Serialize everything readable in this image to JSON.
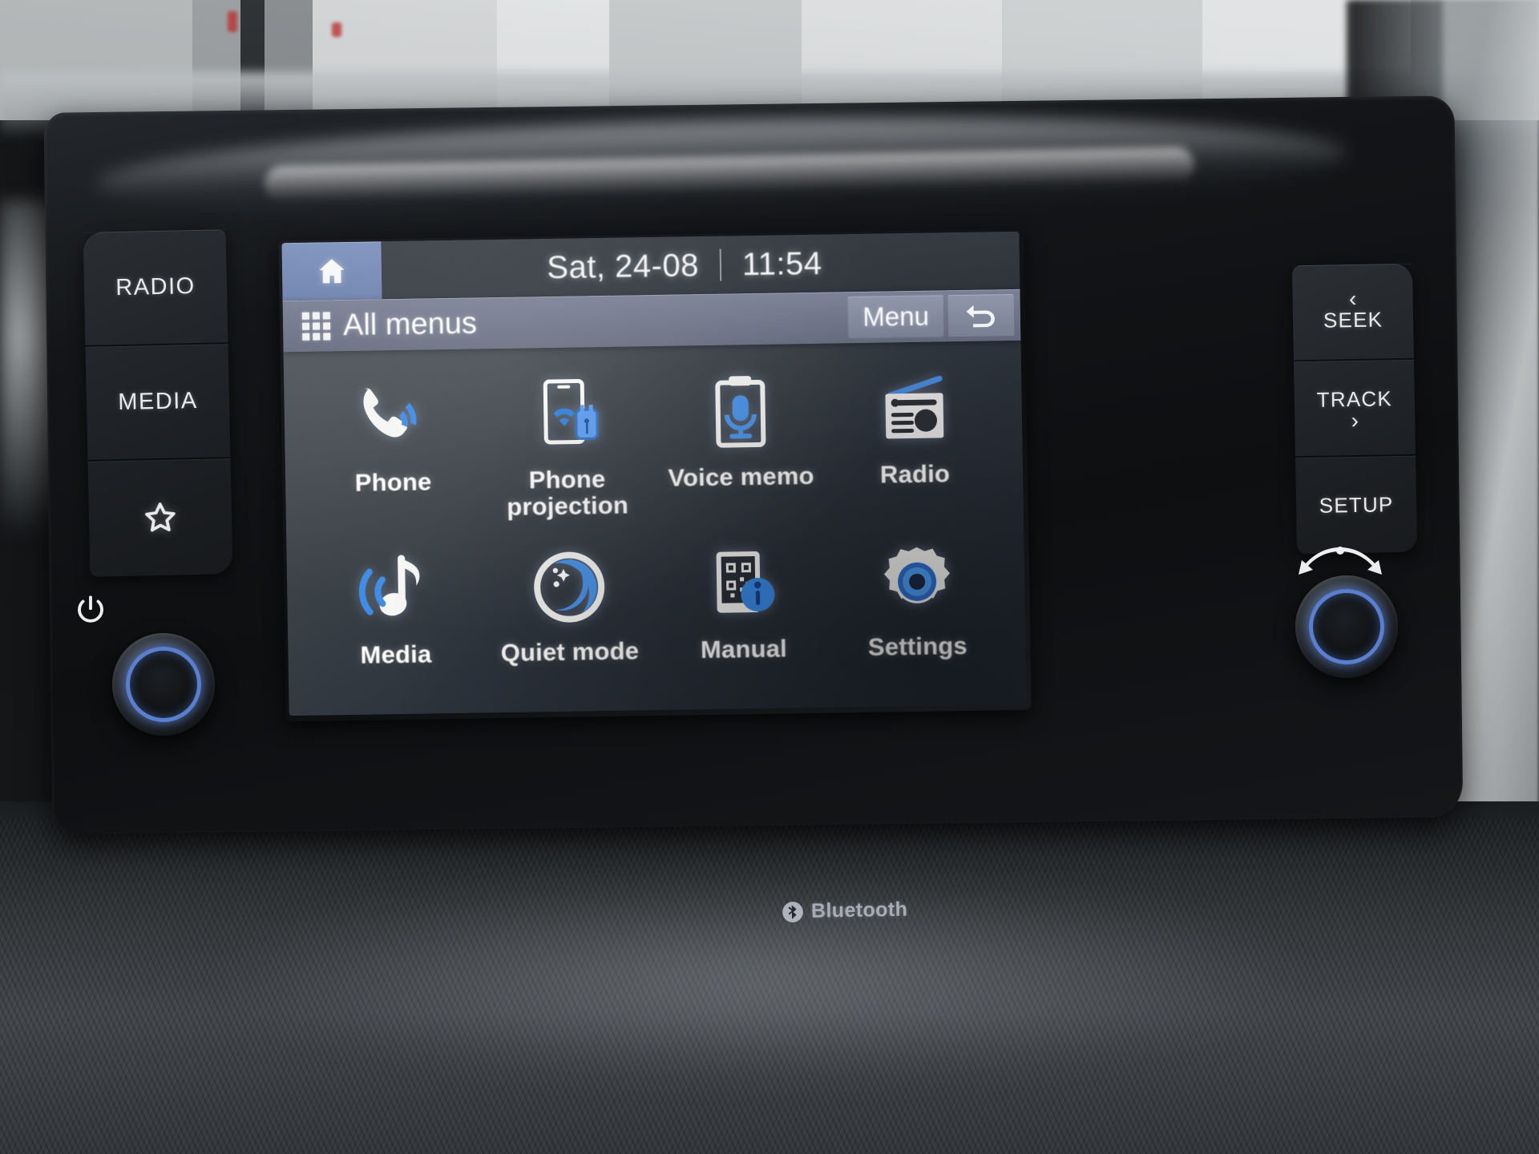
{
  "device": {
    "name": "Car infotainment head unit",
    "brand_badge": "Bluetooth"
  },
  "screen": {
    "status_bar": {
      "home_icon": "home-icon",
      "date": "Sat, 24-08",
      "time": "11:54"
    },
    "title_bar": {
      "grid_icon": "grid-icon",
      "title": "All menus",
      "menu_label": "Menu",
      "back_icon": "back-arrow-icon"
    },
    "menu_items": [
      {
        "label": "Phone",
        "icon": "phone-handset-icon",
        "row": 1,
        "col": 1
      },
      {
        "label": "Phone\nprojection",
        "icon": "phone-projection-icon",
        "row": 1,
        "col": 2
      },
      {
        "label": "Voice memo",
        "icon": "voice-memo-icon",
        "row": 1,
        "col": 3
      },
      {
        "label": "Radio",
        "icon": "radio-icon",
        "row": 1,
        "col": 4
      },
      {
        "label": "Media",
        "icon": "media-note-icon",
        "row": 2,
        "col": 1
      },
      {
        "label": "Quiet mode",
        "icon": "quiet-mode-moon-icon",
        "row": 2,
        "col": 2
      },
      {
        "label": "Manual",
        "icon": "manual-qr-info-icon",
        "row": 2,
        "col": 3
      },
      {
        "label": "Settings",
        "icon": "settings-gear-icon",
        "row": 2,
        "col": 4
      }
    ]
  },
  "hard_buttons": {
    "left": [
      {
        "label": "RADIO",
        "icon": ""
      },
      {
        "label": "MEDIA",
        "icon": ""
      },
      {
        "label": "",
        "icon": "star-favorites-icon"
      }
    ],
    "right": [
      {
        "label": "SEEK",
        "chevron": "‹",
        "chevron_pos": "top"
      },
      {
        "label": "TRACK",
        "chevron": "›",
        "chevron_pos": "bottom"
      },
      {
        "label": "SETUP",
        "chevron": "",
        "chevron_pos": ""
      }
    ],
    "left_knob": {
      "name": "power-volume-knob",
      "icon": "power-icon"
    },
    "right_knob": {
      "name": "tune-knob",
      "icon": "tune-arrows-icon"
    }
  },
  "colors": {
    "accent_blue": "#2f7fe0",
    "title_bar_blue_grey": "#6f7588",
    "home_tile_blue": "#7f93bd",
    "knob_ring_blue": "#5a7fd0",
    "icon_white": "#f4f5f6",
    "screen_bg_top": "#5a6166",
    "screen_bg_bottom": "#1e242d"
  }
}
